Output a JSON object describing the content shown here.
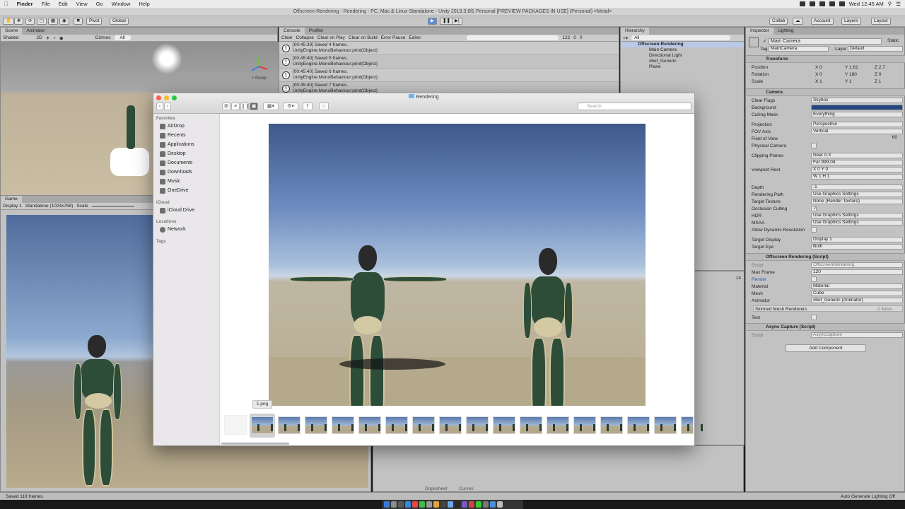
{
  "menubar": {
    "app": "Finder",
    "items": [
      "File",
      "Edit",
      "View",
      "Go",
      "Window",
      "Help"
    ],
    "clock": "Wed 12:45 AM"
  },
  "unity": {
    "title": "Offscreen-Rendering - Rendering - PC, Mac & Linux Standalone - Unity 2019.3.8f1 Personal [PREVIEW PACKAGES IN USE] (Personal) <Metal>",
    "toolbar": {
      "pivot": "Pivot",
      "global": "Global",
      "collab": "Collab",
      "account": "Account",
      "layers": "Layers",
      "layout": "Layout"
    }
  },
  "scene_panel": {
    "tabs": [
      "Scene",
      "Animator"
    ],
    "shading": "Shaded",
    "mode_2d": "2D",
    "gizmos": "Gizmos",
    "search": "All",
    "persp": "< Persp"
  },
  "game_panel": {
    "tab": "Game",
    "display": "Display 1",
    "resolution": "Standalone (1024x768)",
    "scale": "Scale"
  },
  "console_panel": {
    "tabs": [
      "Console",
      "Profiler"
    ],
    "buttons": [
      "Clear",
      "Collapse",
      "Clear on Play",
      "Clear on Build",
      "Error Pause",
      "Editor"
    ],
    "count": "122",
    "counts_zero": [
      "0",
      "0"
    ],
    "rows": [
      {
        "line1": "[00:45:39] Saved 4 frames.",
        "line2": "UnityEngine.MonoBehaviour:print(Object)"
      },
      {
        "line1": "[00:45:40] Saved 5 frames.",
        "line2": "UnityEngine.MonoBehaviour:print(Object)"
      },
      {
        "line1": "[00:45:40] Saved 6 frames.",
        "line2": "UnityEngine.MonoBehaviour:print(Object)"
      },
      {
        "line1": "[00:45:40] Saved 7 frames.",
        "line2": "UnityEngine.MonoBehaviour:print(Object)"
      }
    ]
  },
  "hierarchy_panel": {
    "tab": "Hierarchy",
    "search": "All",
    "root": "Offscreen-Rendering",
    "items": [
      "Main Camera",
      "Directional Light",
      "xbot_Generic",
      "Plane"
    ],
    "count": "14"
  },
  "inspector_panel": {
    "tabs": [
      "Inspector",
      "Lighting"
    ],
    "object_name": "Main Camera",
    "static_label": "Static",
    "tag_label": "Tag",
    "tag_value": "MainCamera",
    "layer_label": "Layer",
    "layer_value": "Default",
    "transform": {
      "header": "Transform",
      "position_label": "Position",
      "position": {
        "x": "0",
        "y": "1.61",
        "z": "2.7"
      },
      "rotation_label": "Rotation",
      "rotation": {
        "x": "0",
        "y": "180",
        "z": "0"
      },
      "scale_label": "Scale",
      "scale": {
        "x": "1",
        "y": "1",
        "z": "1"
      }
    },
    "camera": {
      "header": "Camera",
      "rows": [
        {
          "label": "Clear Flags",
          "value": "Skybox"
        },
        {
          "label": "Background",
          "value": ""
        },
        {
          "label": "Culling Mask",
          "value": "Everything"
        },
        {
          "label": "Projection",
          "value": "Perspective"
        },
        {
          "label": "FOV Axis",
          "value": "Vertical"
        },
        {
          "label": "Field of View",
          "value": "60"
        },
        {
          "label": "Physical Camera",
          "value": ""
        },
        {
          "label": "Clipping Planes",
          "value": "Near  0.3"
        },
        {
          "label": "",
          "value": "Far   999.04"
        },
        {
          "label": "Viewport Rect",
          "value": "X 0      Y 0"
        },
        {
          "label": "",
          "value": "W 1      H 1"
        },
        {
          "label": "Depth",
          "value": "-1"
        },
        {
          "label": "Rendering Path",
          "value": "Use Graphics Settings"
        },
        {
          "label": "Target Texture",
          "value": "None (Render Texture)"
        },
        {
          "label": "Occlusion Culling",
          "value": "✓"
        },
        {
          "label": "HDR",
          "value": "Use Graphics Settings"
        },
        {
          "label": "MSAA",
          "value": "Use Graphics Settings"
        },
        {
          "label": "Allow Dynamic Resolution",
          "value": ""
        },
        {
          "label": "Target Display",
          "value": "Display 1"
        },
        {
          "label": "Target Eye",
          "value": "Both"
        }
      ]
    },
    "offscreen": {
      "header": "Offscreen Rendering (Script)",
      "rows": [
        {
          "label": "Script",
          "value": "OffscreenRendering"
        },
        {
          "label": "Max Frame",
          "value": "120"
        },
        {
          "label": "Render",
          "value": ""
        },
        {
          "label": "Material",
          "value": "Material"
        },
        {
          "label": "Mesh",
          "value": "Cube"
        },
        {
          "label": "Animator",
          "value": "xbot_Generic (Animator)"
        }
      ],
      "skinned": "Skinned Mesh Renderers",
      "skinned_count": "2 items",
      "test_label": "Test"
    },
    "async": {
      "header": "Async Capture (Script)",
      "script_label": "Script",
      "script_value": "AsyncCapture"
    },
    "add_component": "Add Component"
  },
  "bottom_tabs": [
    "Dopesheet",
    "Curves"
  ],
  "status": {
    "left": "Saved 119 frames.",
    "right": "Auto Generate Lighting Off"
  },
  "finder": {
    "title": "Rendering",
    "search_placeholder": "Search",
    "sidebar": {
      "favorites_head": "Favorites",
      "favorites": [
        "AirDrop",
        "Recents",
        "Applications",
        "Desktop",
        "Documents",
        "Downloads",
        "Music",
        "OneDrive"
      ],
      "icloud_head": "iCloud",
      "icloud": [
        "iCloud Drive"
      ],
      "locations_head": "Locations",
      "locations": [
        "Network"
      ],
      "tags_head": "Tags"
    },
    "tooltip": "1.png"
  }
}
